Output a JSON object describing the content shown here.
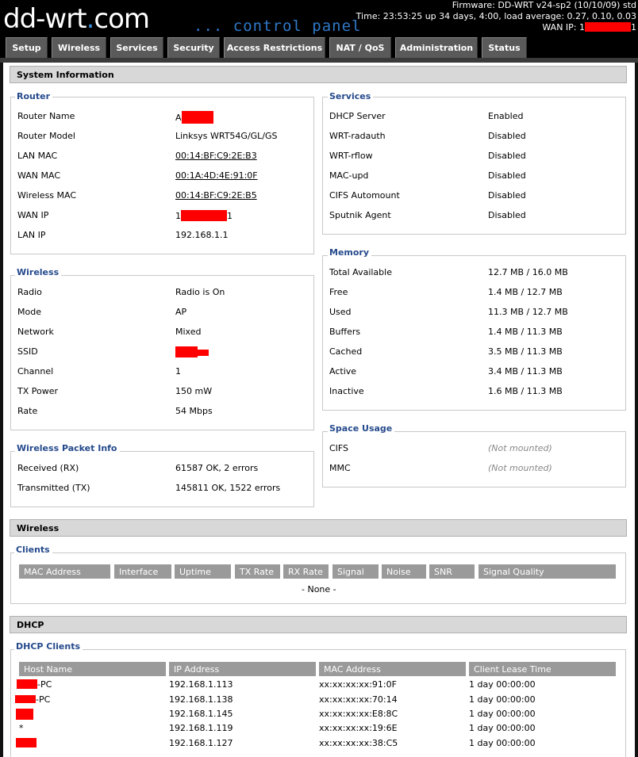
{
  "header": {
    "logo_main": "dd-wrt",
    "logo_dot": ".",
    "logo_com": "com",
    "subtitle": "... control panel",
    "firmware": "Firmware: DD-WRT v24-sp2 (10/10/09) std",
    "time": "Time: 23:53:25 up 34 days, 4:00, load average: 0.27, 0.10, 0.03",
    "wan_ip_label": "WAN IP: 1",
    "wan_ip_suffix": "1"
  },
  "tabs": [
    "Setup",
    "Wireless",
    "Services",
    "Security",
    "Access Restrictions",
    "NAT / QoS",
    "Administration",
    "Status"
  ],
  "system_information": {
    "title": "System Information",
    "router": {
      "legend": "Router",
      "rows": [
        {
          "label": "Router Name",
          "value": "A"
        },
        {
          "label": "Router Model",
          "value": "Linksys WRT54G/GL/GS"
        },
        {
          "label": "LAN MAC",
          "value": "00:14:BF:C9:2E:B3"
        },
        {
          "label": "WAN MAC",
          "value": "00:1A:4D:4E:91:0F"
        },
        {
          "label": "Wireless MAC",
          "value": "00:14:BF:C9:2E:B5"
        },
        {
          "label": "WAN IP",
          "value": "1",
          "value_suffix": "1"
        },
        {
          "label": "LAN IP",
          "value": "192.168.1.1"
        }
      ]
    },
    "services": {
      "legend": "Services",
      "rows": [
        {
          "label": "DHCP Server",
          "value": "Enabled"
        },
        {
          "label": "WRT-radauth",
          "value": "Disabled"
        },
        {
          "label": "WRT-rflow",
          "value": "Disabled"
        },
        {
          "label": "MAC-upd",
          "value": "Disabled"
        },
        {
          "label": "CIFS Automount",
          "value": "Disabled"
        },
        {
          "label": "Sputnik Agent",
          "value": "Disabled"
        }
      ]
    },
    "wireless": {
      "legend": "Wireless",
      "rows": [
        {
          "label": "Radio",
          "value": "Radio is On"
        },
        {
          "label": "Mode",
          "value": "AP"
        },
        {
          "label": "Network",
          "value": "Mixed"
        },
        {
          "label": "SSID",
          "value": ""
        },
        {
          "label": "Channel",
          "value": "1"
        },
        {
          "label": "TX Power",
          "value": "150 mW"
        },
        {
          "label": "Rate",
          "value": "54 Mbps"
        }
      ]
    },
    "memory": {
      "legend": "Memory",
      "rows": [
        {
          "label": "Total Available",
          "value": "12.7 MB / 16.0 MB"
        },
        {
          "label": "Free",
          "value": "1.4 MB / 12.7 MB"
        },
        {
          "label": "Used",
          "value": "11.3 MB / 12.7 MB"
        },
        {
          "label": "Buffers",
          "value": "1.4 MB / 11.3 MB"
        },
        {
          "label": "Cached",
          "value": "3.5 MB / 11.3 MB"
        },
        {
          "label": "Active",
          "value": "3.4 MB / 11.3 MB"
        },
        {
          "label": "Inactive",
          "value": "1.6 MB / 11.3 MB"
        }
      ]
    },
    "packet_info": {
      "legend": "Wireless Packet Info",
      "rows": [
        {
          "label": "Received (RX)",
          "value": "61587 OK, 2 errors"
        },
        {
          "label": "Transmitted (TX)",
          "value": "145811 OK, 1522 errors"
        }
      ]
    },
    "space_usage": {
      "legend": "Space Usage",
      "rows": [
        {
          "label": "CIFS",
          "value": "(Not mounted)"
        },
        {
          "label": "MMC",
          "value": "(Not mounted)"
        }
      ]
    }
  },
  "wireless_section": {
    "title": "Wireless",
    "clients_legend": "Clients",
    "columns": [
      "MAC Address",
      "Interface",
      "Uptime",
      "TX Rate",
      "RX Rate",
      "Signal",
      "Noise",
      "SNR",
      "Signal Quality"
    ],
    "empty_text": "- None -"
  },
  "dhcp_section": {
    "title": "DHCP",
    "clients_legend": "DHCP Clients",
    "columns": [
      "Host Name",
      "IP Address",
      "MAC Address",
      "Client Lease Time"
    ],
    "rows": [
      {
        "host": "-PC",
        "ip": "192.168.1.113",
        "mac": "xx:xx:xx:xx:91:0F",
        "lease": "1 day 00:00:00"
      },
      {
        "host": "-PC",
        "ip": "192.168.1.138",
        "mac": "xx:xx:xx:xx:70:14",
        "lease": "1 day 00:00:00"
      },
      {
        "host": "",
        "ip": "192.168.1.145",
        "mac": "xx:xx:xx:xx:E8:8C",
        "lease": "1 day 00:00:00"
      },
      {
        "host": "*",
        "ip": "192.168.1.119",
        "mac": "xx:xx:xx:xx:19:6E",
        "lease": "1 day 00:00:00"
      },
      {
        "host": "",
        "ip": "192.168.1.127",
        "mac": "xx:xx:xx:xx:38:C5",
        "lease": "1 day 00:00:00"
      }
    ]
  }
}
